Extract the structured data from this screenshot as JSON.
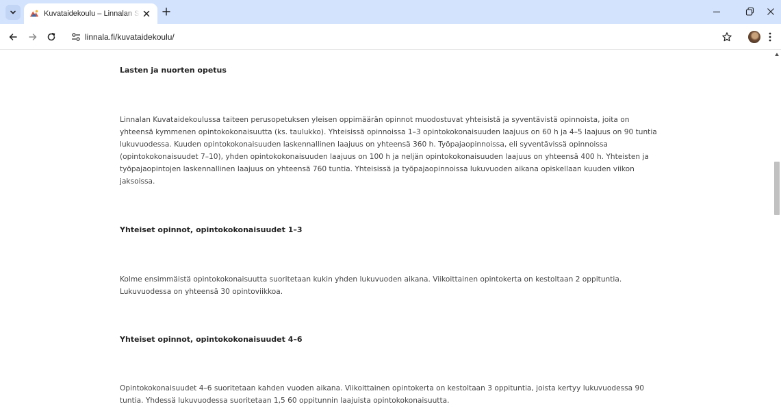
{
  "browser": {
    "tab": {
      "title": "Kuvataidekoulu – Linnalan Setlementti"
    },
    "address_bar": {
      "url": "linnala.fi/kuvataidekoulu/"
    }
  },
  "article": {
    "sections": [
      {
        "heading": "Lasten ja nuorten opetus",
        "paragraph": "Linnalan Kuvataidekoulussa taiteen perusopetuksen yleisen oppimäärän opinnot muodostuvat yhteisistä ja syventävistä opinnoista, joita on yhteensä kymmenen opintokokonaisuutta (ks. taulukko). Yhteisissä opinnoissa 1–3 opintokokonaisuuden laajuus on 60 h ja 4–5 laajuus on 90 tuntia lukuvuodessa. Kuuden opintokokonaisuuden laskennallinen laajuus on yhteensä 360 h. Työpajaopinnoissa, eli syventävissä opinnoissa (opintokokonaisuudet 7–10), yhden opintokokonaisuuden laajuus on 100 h ja neljän opintokokonaisuuden laajuus on yhteensä 400 h. Yhteisten ja työpajaopintojen laskennallinen laajuus on yhteensä 760 tuntia. Yhteisissä ja työpajaopinnoissa lukuvuoden aikana opiskellaan kuuden viikon jaksoissa."
      },
      {
        "heading": "Yhteiset opinnot, opintokokonaisuudet 1–3",
        "paragraph": "Kolme ensimmäistä opintokokonaisuutta suoritetaan kukin yhden lukuvuoden aikana. Viikoittainen opintokerta on kestoltaan 2 oppituntia. Lukuvuodessa on yhteensä 30 opintoviikkoa."
      },
      {
        "heading": "Yhteiset opinnot, opintokokonaisuudet 4–6",
        "paragraph": "Opintokokonaisuudet 4–6 suoritetaan kahden vuoden aikana. Viikoittainen opintokerta on kestoltaan 3 oppituntia, joista kertyy lukuvuodessa 90 tuntia. Yhdessä lukuvuodessa suoritetaan 1,5 60 oppitunnin laajuista opintokokonaisuutta."
      }
    ]
  },
  "colors": {
    "tabstrip_bg": "#d3e3fd",
    "page_bg": "#ffffff",
    "scroll_thumb": "#c1c1c1"
  },
  "icons": {
    "tab_search": "chevron-down-icon",
    "tab_close": "close-icon",
    "new_tab": "plus-icon",
    "back": "arrow-left-icon",
    "forward": "arrow-right-icon",
    "reload": "reload-icon",
    "site_info": "tune-icon",
    "bookmark": "star-icon",
    "menu": "kebab-menu-icon",
    "minimize": "minimize-icon",
    "restore": "restore-icon",
    "close_window": "close-icon"
  }
}
